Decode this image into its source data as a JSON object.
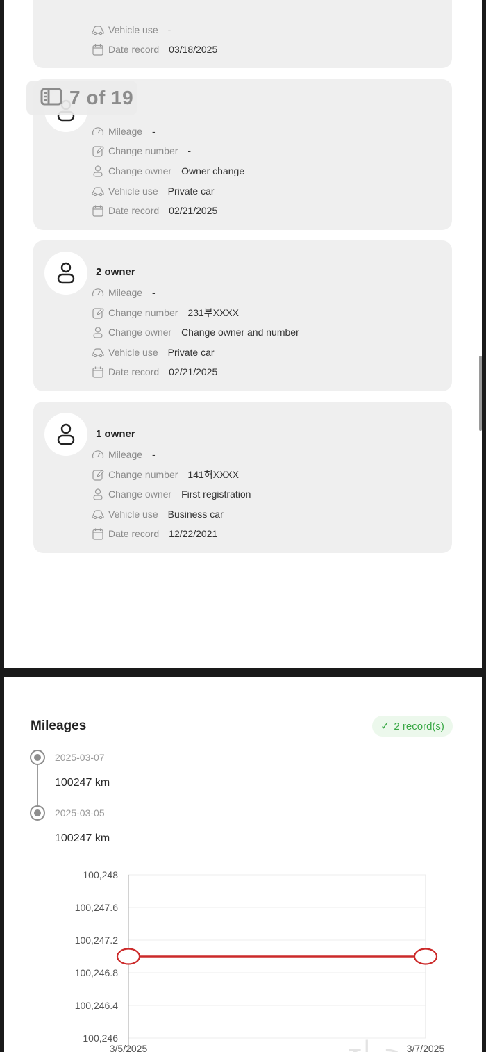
{
  "counter": {
    "text": "7 of 19"
  },
  "top_card": {
    "rows": [
      {
        "label": "Vehicle use",
        "value": "-"
      },
      {
        "label": "Date record",
        "value": "03/18/2025"
      }
    ]
  },
  "card_a": {
    "rows": [
      {
        "label": "Mileage",
        "value": "-"
      },
      {
        "label": "Change number",
        "value": "-"
      },
      {
        "label": "Change owner",
        "value": "Owner change"
      },
      {
        "label": "Vehicle use",
        "value": "Private car"
      },
      {
        "label": "Date record",
        "value": "02/21/2025"
      }
    ]
  },
  "card_b": {
    "title": "2 owner",
    "rows": [
      {
        "label": "Mileage",
        "value": "-"
      },
      {
        "label": "Change number",
        "value": "231부XXXX"
      },
      {
        "label": "Change owner",
        "value": "Change owner and number"
      },
      {
        "label": "Vehicle use",
        "value": "Private car"
      },
      {
        "label": "Date record",
        "value": "02/21/2025"
      }
    ]
  },
  "card_c": {
    "title": "1 owner",
    "rows": [
      {
        "label": "Mileage",
        "value": "-"
      },
      {
        "label": "Change number",
        "value": "141허XXXX"
      },
      {
        "label": "Change owner",
        "value": "First registration"
      },
      {
        "label": "Vehicle use",
        "value": "Business car"
      },
      {
        "label": "Date record",
        "value": "12/22/2021"
      }
    ]
  },
  "mileages": {
    "title": "Mileages",
    "badge": "2 record(s)",
    "badge_color": "#39a845",
    "timeline": [
      {
        "date": "2025-03-07",
        "value": "100247 km"
      },
      {
        "date": "2025-03-05",
        "value": "100247 km"
      }
    ]
  },
  "chart_data": {
    "type": "line",
    "x": [
      "3/5/2025",
      "3/7/2025"
    ],
    "series": [
      {
        "values": [
          100247,
          100247
        ],
        "color": "#cc2a2a"
      }
    ],
    "yticks": [
      "100,248",
      "100,247.6",
      "100,247.2",
      "100,246.8",
      "100,246.4",
      "100,246"
    ],
    "ylim": [
      100246,
      100248
    ],
    "grid": true
  },
  "watermark": {
    "text": "حراج"
  }
}
